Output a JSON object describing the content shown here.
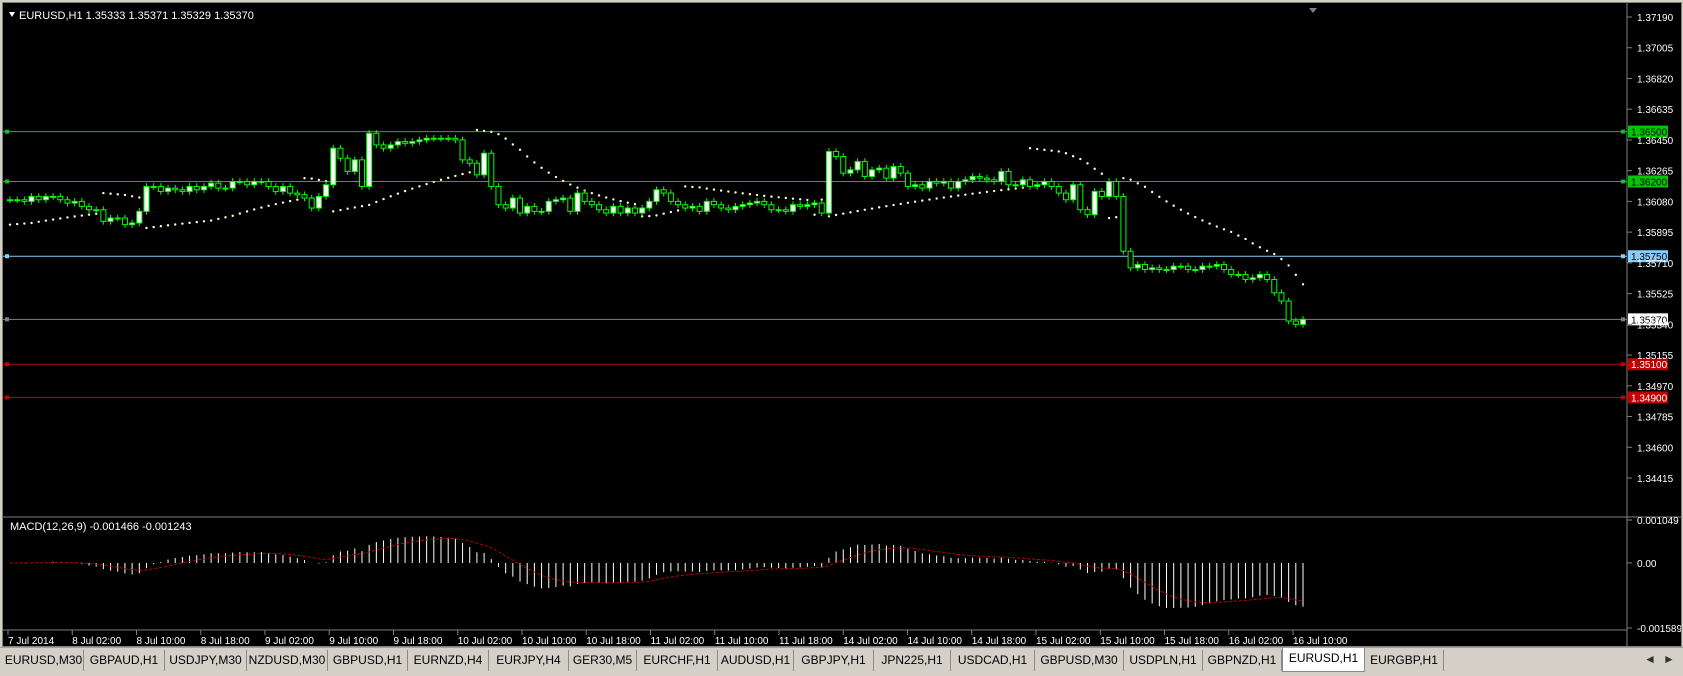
{
  "chart": {
    "header": "EURUSD,H1  1.35333 1.35371 1.35329 1.35370",
    "indicator_label": "MACD(12,26,9) -0.001466 -0.001243",
    "colors": {
      "background": "#000000",
      "candle_up": "#ffffff",
      "candle_down": "#000000",
      "candle_outline": "#00ff00",
      "sar": "#ffffcc",
      "line_green": "#00c800",
      "line_cyan": "#87cefa",
      "line_red": "#c00000",
      "line_price": "#808080",
      "macd_hist": "#ffffff",
      "macd_signal": "#c00000"
    }
  },
  "chart_data": {
    "type": "candlestick",
    "symbol": "EURUSD",
    "timeframe": "H1",
    "price_axis_ticks": [
      "1.37190",
      "1.37005",
      "1.36820",
      "1.36635",
      "1.36450",
      "1.36265",
      "1.36080",
      "1.35895",
      "1.35710",
      "1.35525",
      "1.35340",
      "1.35155",
      "1.34970",
      "1.34785",
      "1.34600",
      "1.34415"
    ],
    "ylim": [
      1.34415,
      1.3719
    ],
    "time_axis_labels": [
      "7 Jul 2014",
      "8 Jul 02:00",
      "8 Jul 10:00",
      "8 Jul 18:00",
      "9 Jul 02:00",
      "9 Jul 10:00",
      "9 Jul 18:00",
      "10 Jul 02:00",
      "10 Jul 10:00",
      "10 Jul 18:00",
      "11 Jul 02:00",
      "11 Jul 10:00",
      "11 Jul 18:00",
      "14 Jul 02:00",
      "14 Jul 10:00",
      "14 Jul 18:00",
      "15 Jul 02:00",
      "15 Jul 10:00",
      "15 Jul 18:00",
      "16 Jul 02:00",
      "16 Jul 10:00"
    ],
    "close_series": [
      1.3609,
      1.3609,
      1.3608,
      1.3611,
      1.3609,
      1.3611,
      1.3611,
      1.3609,
      1.3607,
      1.3608,
      1.3605,
      1.3603,
      1.3603,
      1.3596,
      1.3598,
      1.3598,
      1.3594,
      1.3595,
      1.3602,
      1.3617,
      1.3617,
      1.3614,
      1.3616,
      1.3615,
      1.3614,
      1.3617,
      1.3615,
      1.3617,
      1.3619,
      1.3616,
      1.3616,
      1.362,
      1.362,
      1.3618,
      1.362,
      1.362,
      1.3617,
      1.3614,
      1.3617,
      1.3613,
      1.3612,
      1.361,
      1.3604,
      1.3611,
      1.3618,
      1.364,
      1.3634,
      1.3626,
      1.3633,
      1.3617,
      1.3649,
      1.3642,
      1.364,
      1.3642,
      1.3644,
      1.3643,
      1.3644,
      1.3645,
      1.3646,
      1.3646,
      1.3646,
      1.3646,
      1.3645,
      1.3633,
      1.3631,
      1.3624,
      1.3637,
      1.3617,
      1.3606,
      1.3604,
      1.361,
      1.3601,
      1.3605,
      1.3602,
      1.3602,
      1.3608,
      1.3609,
      1.361,
      1.3602,
      1.3613,
      1.3608,
      1.3606,
      1.3603,
      1.3601,
      1.3605,
      1.3601,
      1.3604,
      1.3601,
      1.3604,
      1.3608,
      1.3615,
      1.3613,
      1.3608,
      1.3606,
      1.3604,
      1.3605,
      1.3602,
      1.3608,
      1.3606,
      1.3604,
      1.3603,
      1.3605,
      1.3606,
      1.3607,
      1.3608,
      1.3606,
      1.3603,
      1.3603,
      1.3602,
      1.3606,
      1.3605,
      1.3606,
      1.3607,
      1.3601,
      1.3638,
      1.3635,
      1.3625,
      1.3627,
      1.3632,
      1.3623,
      1.3627,
      1.3628,
      1.3622,
      1.3629,
      1.3625,
      1.3617,
      1.3618,
      1.3616,
      1.362,
      1.3619,
      1.362,
      1.3616,
      1.362,
      1.3621,
      1.3623,
      1.3622,
      1.3621,
      1.362,
      1.3626,
      1.3618,
      1.3618,
      1.3621,
      1.3617,
      1.3618,
      1.362,
      1.3617,
      1.3613,
      1.3609,
      1.3618,
      1.3603,
      1.36,
      1.3614,
      1.3611,
      1.362,
      1.3611,
      1.3578,
      1.3568,
      1.357,
      1.3567,
      1.3568,
      1.3567,
      1.3567,
      1.3569,
      1.3569,
      1.3567,
      1.3567,
      1.3569,
      1.3569,
      1.357,
      1.3567,
      1.3564,
      1.3564,
      1.3561,
      1.3562,
      1.3564,
      1.3561,
      1.3553,
      1.3548,
      1.3536,
      1.3534,
      1.3537
    ],
    "horizontal_levels": [
      {
        "price": 1.365,
        "label": "1.36500",
        "color": "green"
      },
      {
        "price": 1.362,
        "label": "1.36200",
        "color": "green"
      },
      {
        "price": 1.3575,
        "label": "1.35750",
        "color": "cyan"
      },
      {
        "price": 1.3537,
        "label": "1.35370",
        "color": "gray"
      },
      {
        "price": 1.351,
        "label": "1.35100",
        "color": "red"
      },
      {
        "price": 1.349,
        "label": "1.34900",
        "color": "red"
      }
    ],
    "macd": {
      "axis_ticks": [
        "0.001049",
        "0.00",
        "-0.001589"
      ],
      "ylim": [
        -0.001589,
        0.001049
      ],
      "last_main": -0.001466,
      "last_signal": -0.001243
    }
  },
  "tabs": [
    {
      "label": "EURUSD,M30",
      "active": false
    },
    {
      "label": "GBPAUD,H1",
      "active": false
    },
    {
      "label": "USDJPY,M30",
      "active": false
    },
    {
      "label": "NZDUSD,M30",
      "active": false
    },
    {
      "label": "GBPUSD,H1",
      "active": false
    },
    {
      "label": "EURNZD,H4",
      "active": false
    },
    {
      "label": "EURJPY,H4",
      "active": false
    },
    {
      "label": "GER30,M5",
      "active": false
    },
    {
      "label": "EURCHF,H1",
      "active": false
    },
    {
      "label": "AUDUSD,H1",
      "active": false
    },
    {
      "label": "GBPJPY,H1",
      "active": false
    },
    {
      "label": "JPN225,H1",
      "active": false
    },
    {
      "label": "USDCAD,H1",
      "active": false
    },
    {
      "label": "GBPUSD,M30",
      "active": false
    },
    {
      "label": "USDPLN,H1",
      "active": false
    },
    {
      "label": "GBPNZD,H1",
      "active": false
    },
    {
      "label": "EURUSD,H1",
      "active": true
    },
    {
      "label": "EURGBP,H1",
      "active": false
    }
  ],
  "nav": {
    "left_arrow": "◄",
    "right_arrow": "►"
  }
}
